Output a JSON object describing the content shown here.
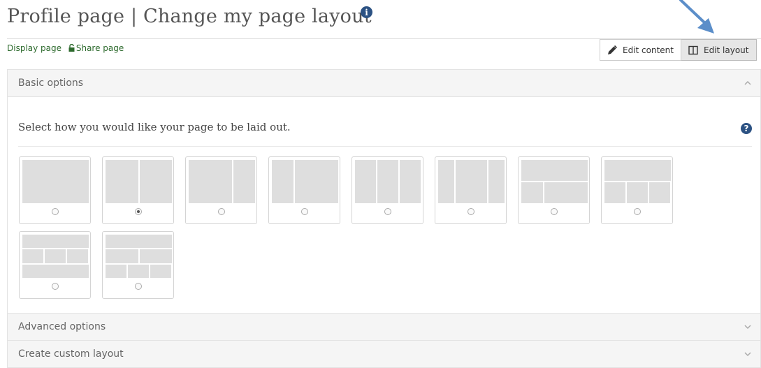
{
  "header": {
    "title": "Profile page | Change my page layout",
    "info_icon": "info-circle-icon"
  },
  "links": {
    "display_page": "Display page",
    "share_page": "Share page"
  },
  "toolbar": {
    "edit_content": "Edit content",
    "edit_layout": "Edit layout",
    "active": "edit_layout"
  },
  "basic_options": {
    "title": "Basic options",
    "expanded": true,
    "instruction": "Select how you would like your page to be laid out.",
    "selected_index": 1,
    "layouts": [
      {
        "rows": [
          [
            100
          ]
        ]
      },
      {
        "rows": [
          [
            50,
            50
          ]
        ]
      },
      {
        "rows": [
          [
            67,
            33
          ]
        ]
      },
      {
        "rows": [
          [
            33,
            67
          ]
        ]
      },
      {
        "rows": [
          [
            33,
            33,
            33
          ]
        ]
      },
      {
        "rows": [
          [
            25,
            50,
            25
          ]
        ]
      },
      {
        "rows": [
          [
            100
          ],
          [
            33,
            67
          ]
        ]
      },
      {
        "rows": [
          [
            100
          ],
          [
            33,
            33,
            33
          ]
        ]
      },
      {
        "rows": [
          [
            100
          ],
          [
            33,
            33,
            33
          ],
          [
            100
          ]
        ]
      },
      {
        "rows": [
          [
            100
          ],
          [
            50,
            50
          ],
          [
            33,
            33,
            33
          ]
        ]
      }
    ]
  },
  "advanced_options": {
    "title": "Advanced options",
    "expanded": false
  },
  "custom_layout": {
    "title": "Create custom layout",
    "expanded": false
  },
  "colors": {
    "link": "#2d6a2d",
    "icon": "#2c5283",
    "arrow": "#5b8ec9",
    "block": "#dedede"
  }
}
